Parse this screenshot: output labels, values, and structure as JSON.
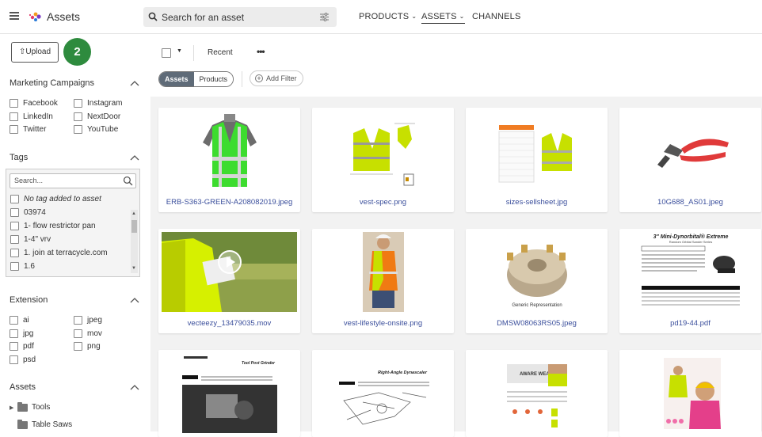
{
  "header": {
    "app_title": "Assets",
    "search_placeholder": "Search for an asset",
    "nav": [
      {
        "label": "PRODUCTS",
        "has_menu": true
      },
      {
        "label": "ASSETS",
        "has_menu": true,
        "active": true
      },
      {
        "label": "CHANNELS",
        "has_menu": false
      }
    ]
  },
  "sidebar": {
    "upload_label": "Upload",
    "badge_count": "2",
    "marketing": {
      "title": "Marketing Campaigns",
      "items": [
        "Facebook",
        "Instagram",
        "LinkedIn",
        "NextDoor",
        "Twitter",
        "YouTube"
      ]
    },
    "tags": {
      "title": "Tags",
      "search_placeholder": "Search...",
      "items": [
        "No tag added to asset",
        "03974",
        "1- flow restrictor pan",
        "1-4\" vrv",
        "1. join at terracycle.com",
        "1.6"
      ]
    },
    "extension": {
      "title": "Extension",
      "items": [
        "ai",
        "jpeg",
        "jpg",
        "mov",
        "pdf",
        "png",
        "psd"
      ]
    },
    "assets": {
      "title": "Assets",
      "items": [
        "Tools",
        "Table Saws"
      ]
    }
  },
  "toolbar": {
    "sort_label": "Recent",
    "more_label": "•••",
    "segments": [
      "Assets",
      "Products"
    ],
    "add_filter_label": "Add Filter"
  },
  "grid": {
    "assets": [
      "ERB-S363-GREEN-A208082019.jpeg",
      "vest-spec.png",
      "sizes-sellsheet.jpg",
      "10G688_AS01.jpeg",
      "vecteezy_13479035.mov",
      "vest-lifestyle-onsite.png",
      "DMSW08063RS05.jpeg",
      "pd19-44.pdf"
    ],
    "thumb_texts": {
      "dmsw_caption": "Generic Representation",
      "pd19_title": "3\" Mini-Dynorbital® Extreme",
      "pd19_subtitle": "Random Orbital Sander Series",
      "row3_a_title": "Tool Post Grinder",
      "row3_b_title": "Right-Angle Dynascaler",
      "row3_c_title": "AWARE WEAR"
    }
  },
  "colors": {
    "accent_green": "#2e8b3e",
    "link_blue": "#3b4f9c",
    "segment_active": "#5f6b78"
  }
}
